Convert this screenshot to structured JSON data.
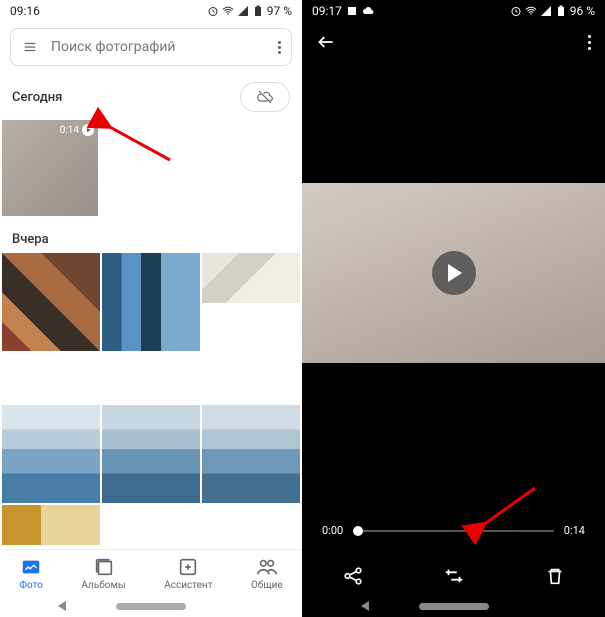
{
  "left": {
    "status": {
      "time": "09:16",
      "battery": "97 %"
    },
    "search_placeholder": "Поиск фотографий",
    "section_today": "Сегодня",
    "video_duration": "0:14",
    "section_yesterday": "Вчера",
    "nav": {
      "photos": "Фото",
      "albums": "Альбомы",
      "assistant": "Ассистент",
      "sharing": "Общие"
    }
  },
  "right": {
    "status": {
      "time": "09:17",
      "battery": "96 %"
    },
    "scrub_start": "0:00",
    "scrub_end": "0:14"
  }
}
